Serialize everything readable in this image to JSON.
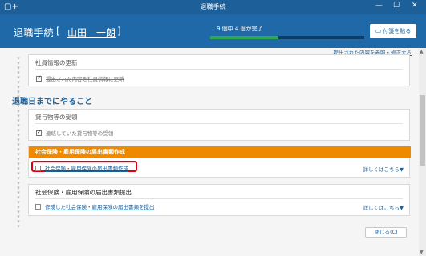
{
  "window": {
    "title": "退職手続",
    "min_glyph": "—",
    "max_glyph": "☐",
    "close_glyph": "✕",
    "app_icon_glyph": "▢+"
  },
  "header": {
    "label": "退職手続",
    "bracket_open": "[",
    "bracket_close": "]",
    "employee_name": "山田　一朗",
    "progress_text": "9 個中 4 個が完了",
    "progress_value": 0.4444,
    "sticky_label": "付箋を貼る",
    "sticky_icon_glyph": "▭"
  },
  "top_link": "提出された内容を参照・修正する",
  "timeline_glyph": "▾",
  "card_employee_update": {
    "title": "社員情報の更新",
    "task": "提出された内容を社員情報に更新"
  },
  "section_heading": "退職日までにやること",
  "card_items_receipt": {
    "title": "貸与物等の受領",
    "task": "連絡していた貸与物等の受領"
  },
  "card_insurance_create": {
    "title": "社会保険・雇用保険の届出書類作成",
    "task": "社会保険・雇用保険の届出書類作成",
    "more": "詳しくはこちら▼"
  },
  "card_insurance_submit": {
    "title": "社会保険・雇用保険の届出書類提出",
    "task": "作成した社会保険・雇用保険の届出書類を提出",
    "more": "詳しくはこちら▼"
  },
  "close_button": "閉じる(C)",
  "scrollbar": {
    "up_glyph": "▲",
    "down_glyph": "▼"
  },
  "colors": {
    "titlebar": "#1d5f98",
    "header": "#1f69a8",
    "progress_fill": "#2ea84e",
    "orange": "#ee8a00",
    "highlight": "#e00010"
  }
}
